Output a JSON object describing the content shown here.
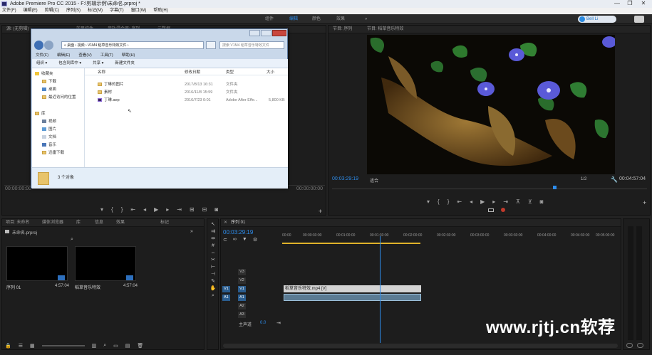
{
  "window": {
    "title": "Adobe Premiere Pro CC 2015 - F:\\剪辑示例\\未命名.prproj *",
    "controls": [
      "—",
      "❐",
      "✕"
    ]
  },
  "menu": [
    "文件(F)",
    "编辑(E)",
    "剪辑(C)",
    "序列(S)",
    "标记(M)",
    "字幕(T)",
    "窗口(W)",
    "帮助(H)"
  ],
  "workspace": {
    "tabs": [
      "组件",
      "编辑",
      "颜色",
      "效果",
      "»"
    ],
    "active": "编辑",
    "sync_label": "Bell Li"
  },
  "source_monitor": {
    "tabs": [
      "源: (无剪辑)",
      "效果控件",
      "音轨混合器: 序列",
      "元数据"
    ],
    "timecode_left": "00:00:00:00",
    "timecode_right": "00:00:00:00"
  },
  "explorer": {
    "path": "« 桌面 › 视频 › V1M4 稻草音乐特效文件 ›",
    "search_placeholder": "搜索 V1M4 稻草音乐特效文件",
    "menu": [
      "文件(F)",
      "编辑(E)",
      "查看(V)",
      "工具(T)",
      "帮助(H)"
    ],
    "toolbar": [
      "组织 ▾",
      "包含到库中 ▾",
      "共享 ▾",
      "新建文件夹"
    ],
    "favorites_header": "收藏夹",
    "favorites": [
      "下载",
      "桌面",
      "最近访问的位置"
    ],
    "libraries_header": "库",
    "libraries": [
      "视频",
      "图片",
      "文档",
      "音乐",
      "迅雷下载"
    ],
    "columns": [
      "名称",
      "修改日期",
      "类型",
      "大小"
    ],
    "files": [
      {
        "name": "丁琳的图片",
        "date": "2017/8/13 16:31",
        "type": "文件夹",
        "size": ""
      },
      {
        "name": "素材",
        "date": "2016/11/8 15:59",
        "type": "文件夹",
        "size": ""
      },
      {
        "name": "丁琳.aep",
        "date": "2016/7/23 0:01",
        "type": "Adobe After Effe...",
        "size": "5,800 KB"
      }
    ],
    "status": "3 个对象"
  },
  "program_monitor": {
    "tabs": [
      "节目: 序列",
      "节目: 稻草音乐特效"
    ],
    "timecode": "00:03:29:19",
    "fit": "适合",
    "quality": "1/2",
    "duration": "00:04:57:04",
    "playhead_fraction": 0.706
  },
  "project": {
    "tabs": [
      "项目: 未命名",
      "媒体浏览器",
      "库",
      "信息",
      "效果",
      "标记"
    ],
    "file_name": "未命名.prproj",
    "items": [
      {
        "name": "序列 01",
        "duration": "4:57:04"
      },
      {
        "name": "稻草音乐特效",
        "duration": "4:57:04"
      }
    ]
  },
  "timeline": {
    "tab": "序列 01",
    "timecode": "00:03:29:19",
    "ruler": [
      "00:00",
      "00:00:30:00",
      "00:01:00:00",
      "00:01:30:00",
      "00:02:00:00",
      "00:02:30:00",
      "00:03:00:00",
      "00:03:30:00",
      "00:04:00:00",
      "00:04:30:00",
      "00:05:00:00"
    ],
    "video_tracks": [
      "V3",
      "V2",
      "V1"
    ],
    "audio_tracks": [
      "A1",
      "A2",
      "A3"
    ],
    "master_label": "主声道",
    "master_value": "0.0",
    "clip_v1": "稻草音乐特效.mp4 [V]",
    "clip_a1": "",
    "playhead_fraction": 0.706
  },
  "watermark": "www.rjtj.cn软荐",
  "colors": {
    "accent": "#2d8ceb",
    "panel": "#1d1d1d",
    "clip_video": "#d3d3d3",
    "clip_audio": "#5b7b93"
  }
}
